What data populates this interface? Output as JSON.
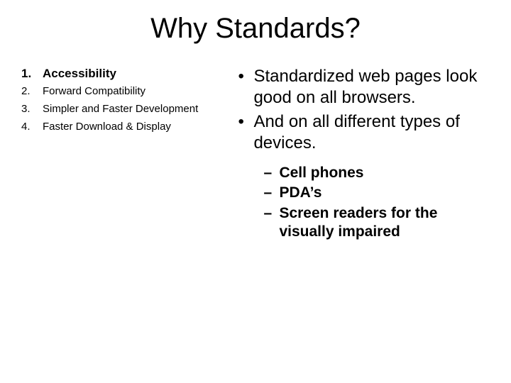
{
  "title": "Why Standards?",
  "left_list": [
    {
      "num": "1.",
      "text": "Accessibility",
      "highlight": true
    },
    {
      "num": "2.",
      "text": "Forward Compatibility",
      "highlight": false
    },
    {
      "num": "3.",
      "text": "Simpler and Faster Development",
      "highlight": false
    },
    {
      "num": "4.",
      "text": "Faster Download & Display",
      "highlight": false
    }
  ],
  "right_bullets": [
    "Standardized web pages look good on all browsers.",
    "And on all different types of devices."
  ],
  "right_sub": [
    "Cell phones",
    "PDA’s",
    "Screen readers for the visually impaired"
  ],
  "glyphs": {
    "bullet": "•",
    "dash": "–"
  }
}
